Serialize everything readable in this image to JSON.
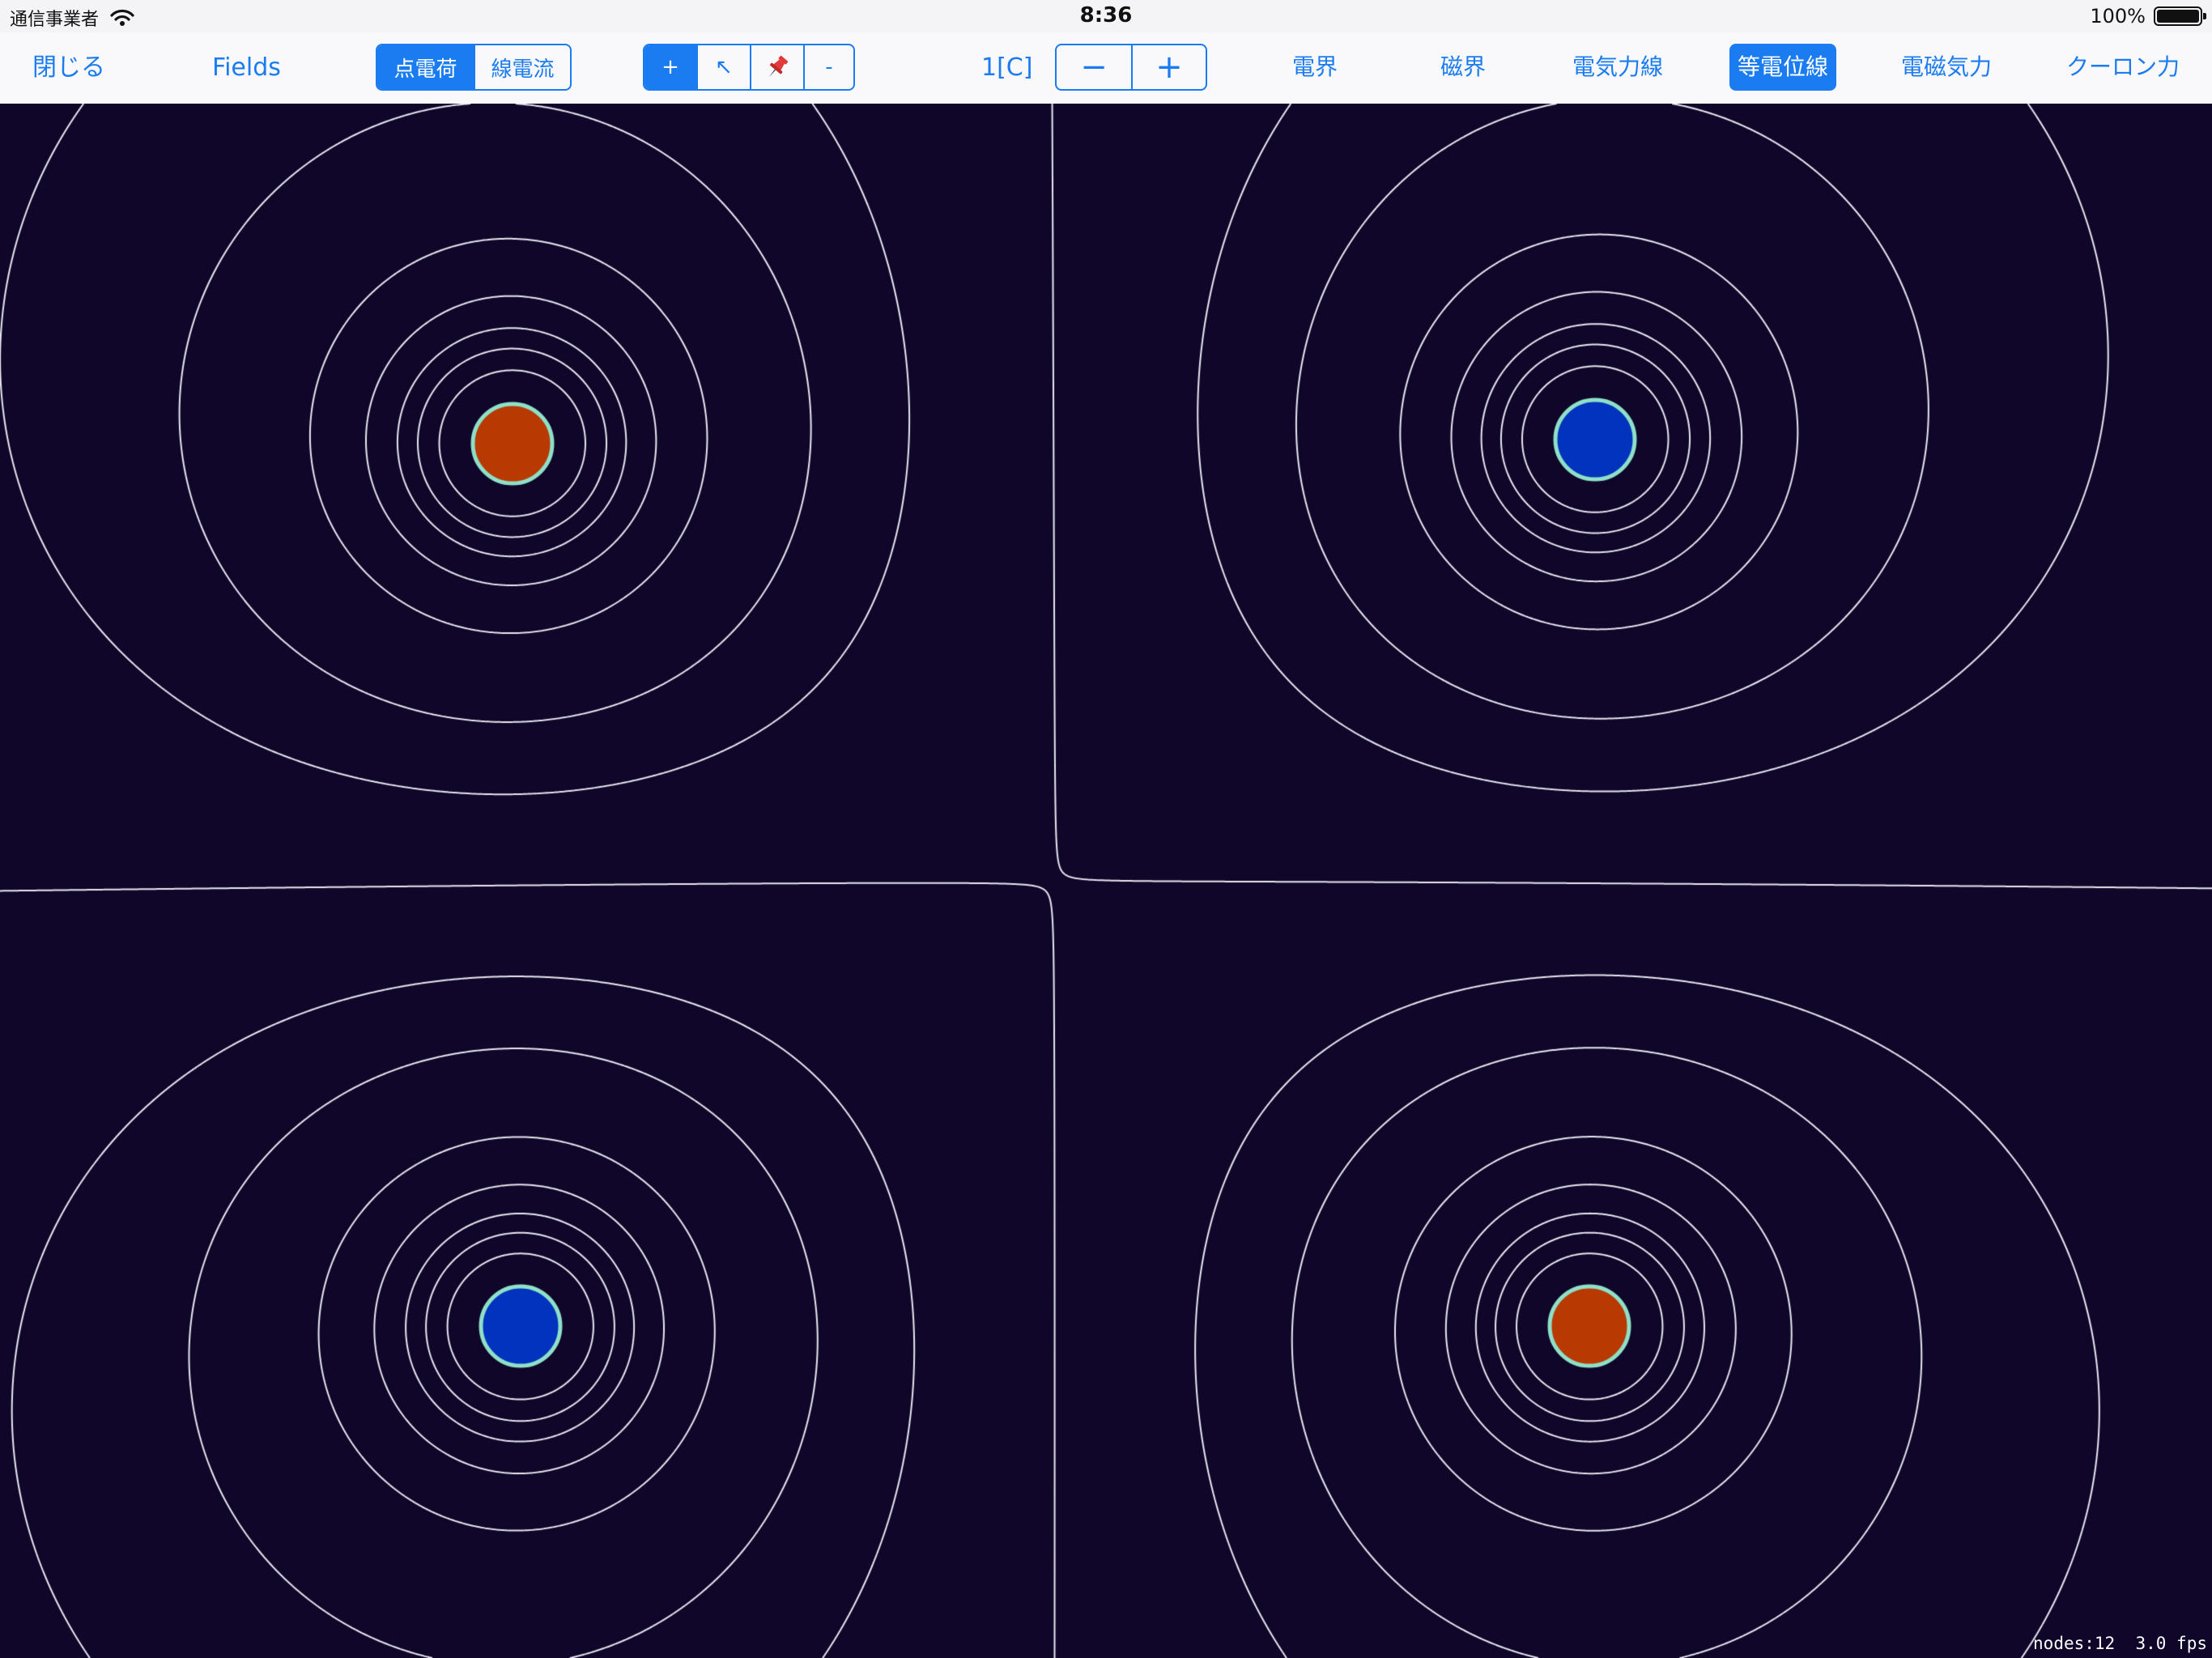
{
  "status_bar": {
    "carrier": "通信事業者",
    "time": "8:36",
    "battery_percent": "100%",
    "wifi_icon": "wifi-icon",
    "battery_icon": "battery-icon"
  },
  "toolbar": {
    "close_label": "閉じる",
    "app_title": "Fields",
    "source_type": {
      "options": [
        "点電荷",
        "線電流"
      ],
      "selected": "点電荷"
    },
    "tools": {
      "add_label": "+",
      "select_icon_glyph": "↖",
      "pin_icon_glyph": "📌",
      "remove_label": "-",
      "selected": "+"
    },
    "charge": {
      "value_label": "1[C]",
      "decrease_label": "−",
      "increase_label": "+"
    },
    "display_toggles": [
      {
        "label": "電界",
        "selected": false
      },
      {
        "label": "磁界",
        "selected": false
      },
      {
        "label": "電気力線",
        "selected": false
      },
      {
        "label": "等電位線",
        "selected": true
      },
      {
        "label": "電磁気力",
        "selected": false
      },
      {
        "label": "クーロン力",
        "selected": false
      }
    ]
  },
  "simulation": {
    "background_color": "#10062a",
    "line_color": "#e8e8f0",
    "positive_color": "#b83a02",
    "negative_color": "#0133be",
    "charge_border_color": "#8ee0c8",
    "charges": [
      {
        "sign": "+",
        "q": 1
      },
      {
        "sign": "-",
        "q": -1
      },
      {
        "sign": "-",
        "q": -1
      },
      {
        "sign": "+",
        "q": 1
      }
    ]
  },
  "hud": {
    "nodes": "nodes:12",
    "fps": "3.0 fps"
  }
}
